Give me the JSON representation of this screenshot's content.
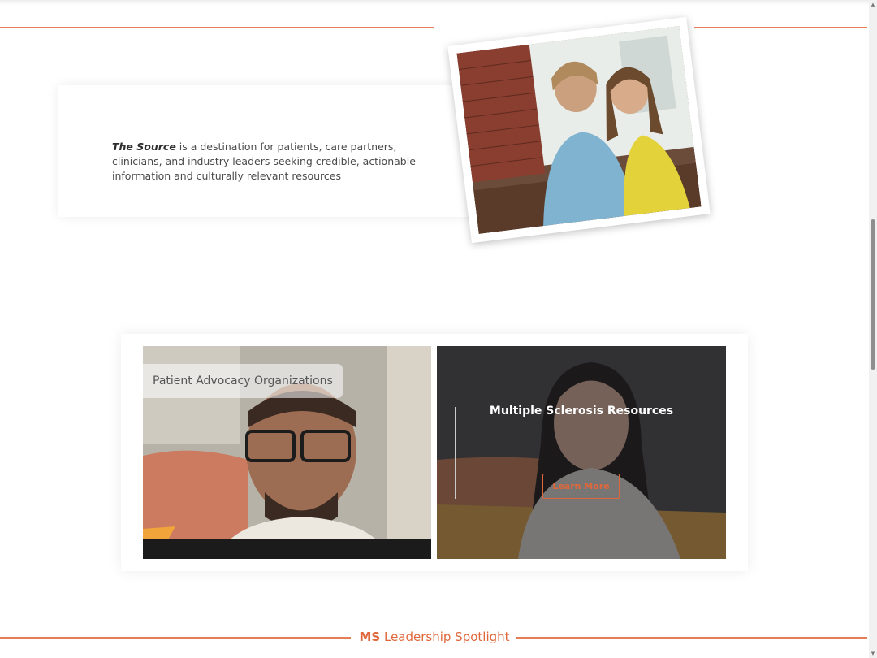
{
  "intro": {
    "brand": "The Source",
    "body": " is a destination for patients, care partners, clinicians, and industry leaders seeking credible, actionable information and culturally relevant resources"
  },
  "cards": {
    "advocacy": {
      "label": "Patient Advocacy Organizations"
    },
    "ms_resources": {
      "title": "Multiple Sclerosis Resources",
      "button": "Learn More"
    }
  },
  "spotlight": {
    "prefix": "MS",
    "title": " Leadership Spotlight"
  },
  "colors": {
    "accent": "#e0673a",
    "card_bg": "#ffffff",
    "dark_overlay": "#2c2c2e"
  },
  "icons": {
    "scroll_up": "triangle-up",
    "scroll_down": "triangle-down"
  }
}
